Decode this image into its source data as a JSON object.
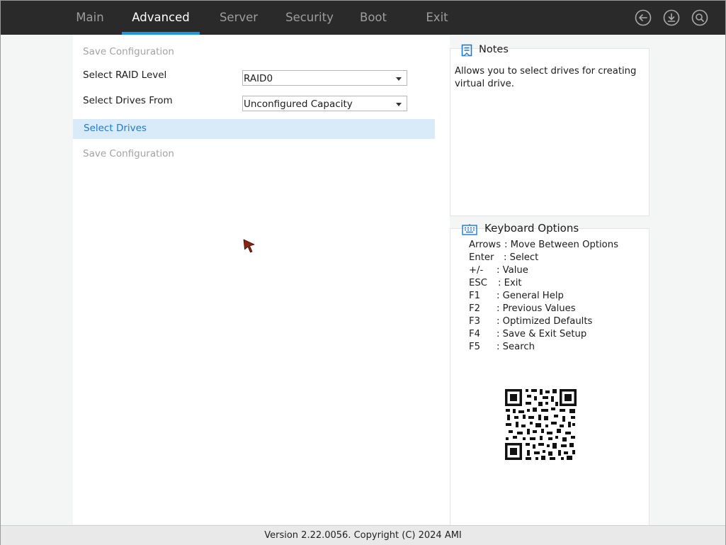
{
  "nav": {
    "tabs": [
      {
        "label": "Main"
      },
      {
        "label": "Advanced",
        "active": true
      },
      {
        "label": "Server"
      },
      {
        "label": "Security"
      },
      {
        "label": "Boot"
      },
      {
        "label": "Exit"
      }
    ],
    "icons": [
      "back-icon",
      "download-icon",
      "search-icon"
    ]
  },
  "main": {
    "top_item": "Save Configuration",
    "raid_label": "Select RAID Level",
    "raid_value": "RAID0",
    "drives_from_label": "Select Drives From",
    "drives_from_value": "Unconfigured Capacity",
    "select_drives": "Select Drives",
    "bottom_item": "Save Configuration"
  },
  "notes": {
    "title": "Notes",
    "text": "Allows you to select drives for creating virtual drive."
  },
  "keyboard": {
    "title": "Keyboard Options",
    "items": [
      {
        "key": "Arrows",
        "desc": ": Move Between Options"
      },
      {
        "key": "Enter",
        "desc": ": Select"
      },
      {
        "key": "+/-",
        "desc": ": Value"
      },
      {
        "key": "ESC",
        "desc": ": Exit"
      },
      {
        "key": "F1",
        "desc": ": General Help"
      },
      {
        "key": "F2",
        "desc": ": Previous Values"
      },
      {
        "key": "F3",
        "desc": ": Optimized Defaults"
      },
      {
        "key": "F4",
        "desc": ": Save & Exit Setup"
      },
      {
        "key": "F5",
        "desc": ": Search"
      }
    ]
  },
  "footer": {
    "text": "Version 2.22.0056. Copyright (C) 2024 AMI"
  },
  "colors": {
    "topbar": "#2a2a2b",
    "accent": "#1f93e6",
    "highlight": "#d9ebf8",
    "highlight_text": "#1f79d2"
  }
}
